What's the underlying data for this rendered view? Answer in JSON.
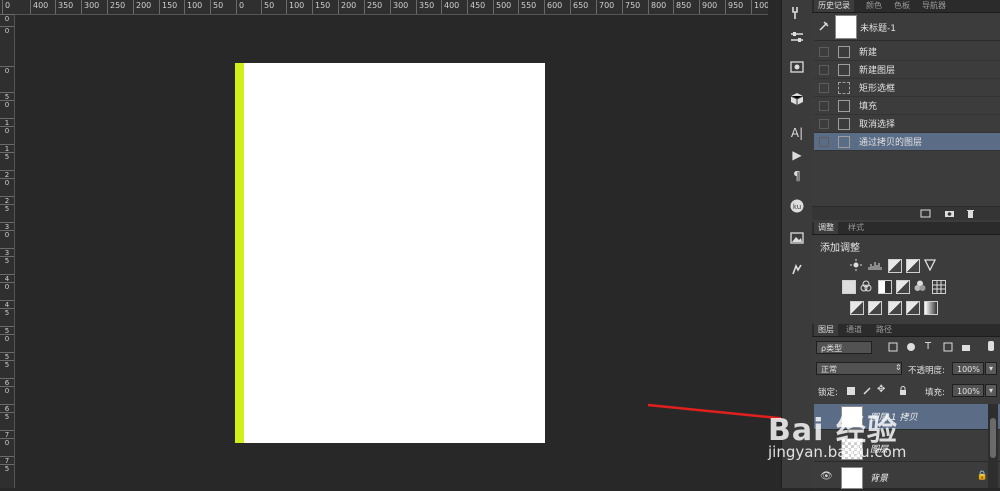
{
  "ruler_top_labels": [
    "0",
    "400",
    "350",
    "300",
    "250",
    "200",
    "150",
    "100",
    "50",
    "0",
    "50",
    "100",
    "150",
    "200",
    "250",
    "300",
    "350",
    "400",
    "450",
    "500",
    "550",
    "600",
    "650",
    "700",
    "750",
    "800",
    "850",
    "900",
    "950",
    "1000"
  ],
  "ruler_left_labels": [
    "0",
    "0",
    "0",
    "5",
    "0",
    "1",
    "0",
    "1",
    "5",
    "2",
    "0",
    "2",
    "5",
    "3",
    "0",
    "3",
    "5",
    "4",
    "0",
    "4",
    "5",
    "5",
    "0",
    "5",
    "5",
    "6",
    "0",
    "6",
    "5",
    "7",
    "0",
    "7",
    "5"
  ],
  "colors": {
    "workspace": "#282828",
    "stripe": "#d2ef19",
    "selection": "#5b6c86",
    "arrow": "#e0201c"
  },
  "tool_icons": [
    "brush-settings-icon",
    "sliders-icon",
    "clone-source-icon",
    "3d-cube-icon",
    "character-icon",
    "play-icon",
    "paragraph-icon",
    "extension-icon",
    "image-icon",
    "pen-icon"
  ],
  "tool_glyphs": {
    "character": "A|",
    "play": "▶",
    "paragraph": "¶"
  },
  "history_panel": {
    "tabs": [
      "历史记录",
      "颜色",
      "色板",
      "导航器"
    ],
    "snapshot_label": "未标题-1",
    "items": [
      "新建",
      "新建图层",
      "矩形选框",
      "填充",
      "取消选择",
      "通过拷贝的图层"
    ],
    "selected_index": 5
  },
  "adjustments_panel": {
    "tabs": [
      "调整",
      "样式"
    ],
    "title": "添加调整"
  },
  "layers_panel": {
    "tabs": [
      "图层",
      "通道",
      "路径"
    ],
    "kind_filter": "ρ类型",
    "blend_mode": "正常",
    "opacity_label": "不透明度:",
    "opacity_value": "100%",
    "lock_label": "锁定:",
    "fill_label": "填充:",
    "fill_value": "100%",
    "layers": [
      {
        "name": "图层 1 拷贝",
        "selected": true,
        "thumb": "white"
      },
      {
        "name": "图层",
        "selected": false,
        "thumb": "checker"
      },
      {
        "name": "背景",
        "selected": false,
        "thumb": "white",
        "locked": true
      }
    ]
  },
  "watermark": {
    "logo": "Bai 经验",
    "url": "jingyan.baidu.com"
  }
}
